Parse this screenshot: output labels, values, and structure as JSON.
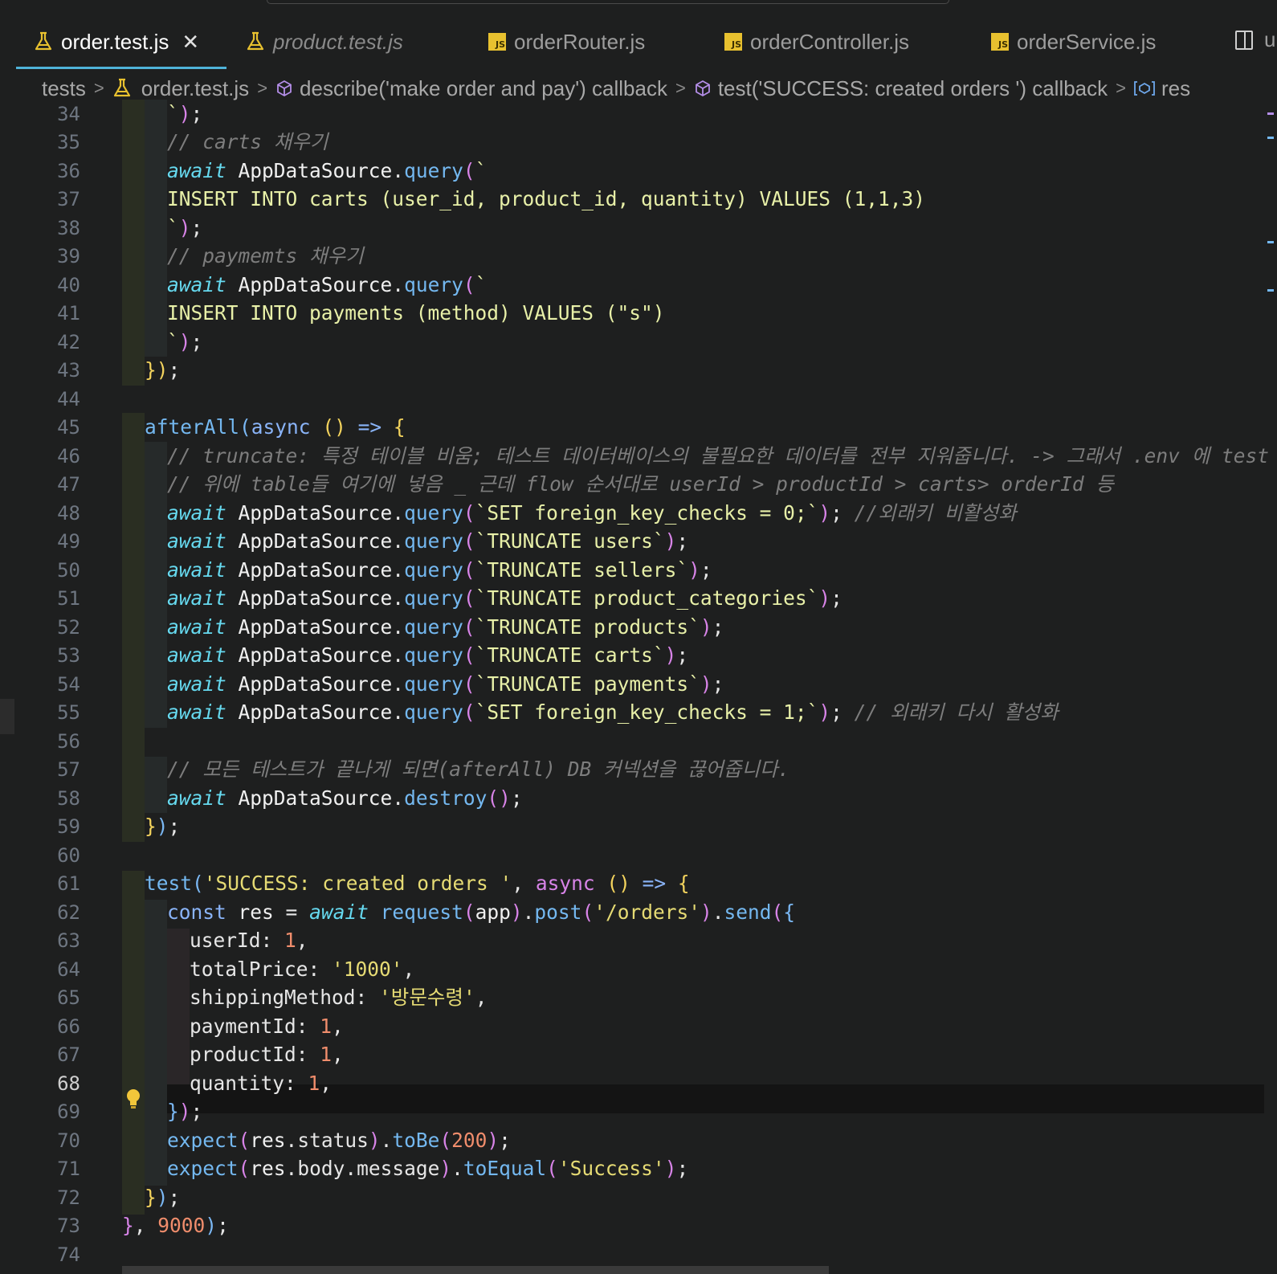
{
  "tabs": [
    {
      "label": "order.test.js",
      "active": true,
      "icon": "flask-icon"
    },
    {
      "label": "product.test.js",
      "active": false,
      "icon": "flask-icon"
    },
    {
      "label": "orderRouter.js",
      "active": false,
      "icon": "js-icon"
    },
    {
      "label": "orderController.js",
      "active": false,
      "icon": "js-icon"
    },
    {
      "label": "orderService.js",
      "active": false,
      "icon": "js-icon"
    }
  ],
  "tab_overflow": "u",
  "js_badge": "JS",
  "close_glyph": "✕",
  "breadcrumb": {
    "folder": "tests",
    "file": "order.test.js",
    "describe": "describe('make order and pay') callback",
    "test": "test('SUCCESS: created orders ') callback",
    "symbol": "res"
  },
  "editor": {
    "current_line": 68,
    "line_numbers": [
      34,
      35,
      36,
      37,
      38,
      39,
      40,
      41,
      42,
      43,
      44,
      45,
      46,
      47,
      48,
      49,
      50,
      51,
      52,
      53,
      54,
      55,
      56,
      57,
      58,
      59,
      60,
      61,
      62,
      63,
      64,
      65,
      66,
      67,
      68,
      69,
      70,
      71,
      72,
      73,
      74
    ],
    "comments": {
      "c35": "// carts 채우기",
      "c39": "// paymemts 채우기",
      "c46": "// truncate: 특정 테이블 비움; 테스트 데이터베이스의 불필요한 데이터를 전부 지워줍니다. -> 그래서 .env 에 test data",
      "c47": "// 위에 table들 여기에 넣음 _ 근데 flow 순서대로 userId > productId > carts> orderId 등",
      "c48": "//외래키 비활성화",
      "c55": "// 외래키 다시 활성화",
      "c57": "// 모든 테스트가 끝나게 되면(afterAll) DB 커넥션을 끊어줍니다."
    },
    "sql": {
      "s37": "INSERT INTO carts (user_id, product_id, quantity) VALUES (1,1,3)",
      "s41": "INSERT INTO payments (method) VALUES (\"s\")",
      "s48": "SET foreign_key_checks = 0;",
      "s49": "TRUNCATE users",
      "s50": "TRUNCATE sellers",
      "s51": "TRUNCATE product_categories",
      "s52": "TRUNCATE products",
      "s53": "TRUNCATE carts",
      "s54": "TRUNCATE payments",
      "s55": "SET foreign_key_checks = 1;"
    },
    "strings": {
      "test_name": "'SUCCESS: created orders '",
      "route": "'/orders'",
      "total_price": "'1000'",
      "shipping": "'방문수령'",
      "success": "'Success'"
    },
    "numbers": {
      "user_id": "1",
      "payment_id": "1",
      "product_id": "1",
      "quantity": "1",
      "status": "200",
      "timeout": "9000"
    }
  },
  "colors": {
    "background": "#1e1f1f",
    "active_tab_underline": "#4fb3d9",
    "js_badge": "#e8c12f"
  }
}
